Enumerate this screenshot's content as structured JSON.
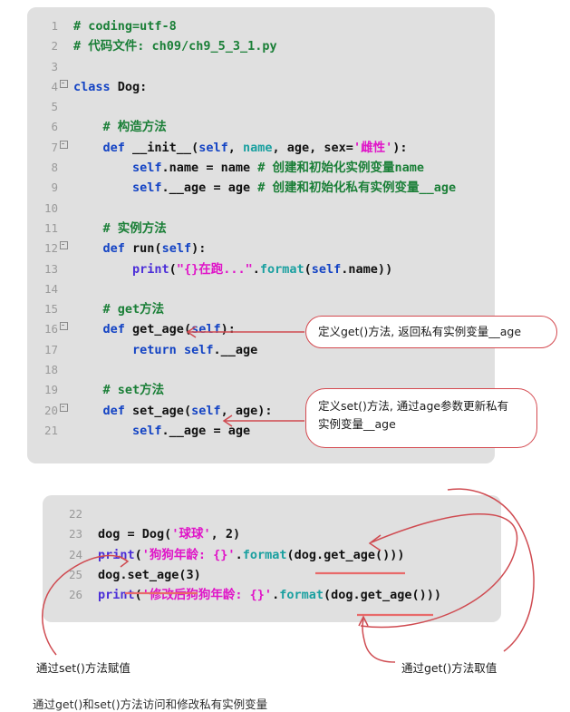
{
  "document": {
    "title": "Python class Dog private attribute get/set example",
    "bottom_caption": "通过get()和set()方法访问和修改私有实例变量"
  },
  "code_block_top": {
    "background": "#e0e0e0",
    "lines": [
      {
        "num": "1",
        "fold": false,
        "tokens": [
          {
            "t": "# coding=utf-8",
            "c": "cmt"
          }
        ]
      },
      {
        "num": "2",
        "fold": false,
        "tokens": [
          {
            "t": "# 代码文件: ch09/ch9_5_3_1.py",
            "c": "cmt"
          }
        ]
      },
      {
        "num": "3",
        "fold": false,
        "tokens": []
      },
      {
        "num": "4",
        "fold": true,
        "tokens": [
          {
            "t": "class ",
            "c": "kw"
          },
          {
            "t": "Dog",
            "c": "cls"
          },
          {
            "t": ":",
            "c": "plain"
          }
        ]
      },
      {
        "num": "5",
        "fold": false,
        "tokens": []
      },
      {
        "num": "6",
        "fold": false,
        "tokens": [
          {
            "t": "    ",
            "c": "plain"
          },
          {
            "t": "# 构造方法",
            "c": "cmt"
          }
        ]
      },
      {
        "num": "7",
        "fold": true,
        "tokens": [
          {
            "t": "    ",
            "c": "plain"
          },
          {
            "t": "def ",
            "c": "kw"
          },
          {
            "t": "__init__",
            "c": "fn"
          },
          {
            "t": "(",
            "c": "plain"
          },
          {
            "t": "self",
            "c": "self"
          },
          {
            "t": ", ",
            "c": "plain"
          },
          {
            "t": "name",
            "c": "param"
          },
          {
            "t": ", ",
            "c": "plain"
          },
          {
            "t": "age",
            "c": "plain"
          },
          {
            "t": ", ",
            "c": "plain"
          },
          {
            "t": "sex=",
            "c": "plain"
          },
          {
            "t": "'雌性'",
            "c": "str"
          },
          {
            "t": "):",
            "c": "plain"
          }
        ]
      },
      {
        "num": "8",
        "fold": false,
        "tokens": [
          {
            "t": "        ",
            "c": "plain"
          },
          {
            "t": "self",
            "c": "self"
          },
          {
            "t": ".name = name ",
            "c": "plain"
          },
          {
            "t": "# 创建和初始化实例变量name",
            "c": "cmt"
          }
        ]
      },
      {
        "num": "9",
        "fold": false,
        "tokens": [
          {
            "t": "        ",
            "c": "plain"
          },
          {
            "t": "self",
            "c": "self"
          },
          {
            "t": ".__age = age ",
            "c": "plain"
          },
          {
            "t": "# 创建和初始化私有实例变量__age",
            "c": "cmt"
          }
        ]
      },
      {
        "num": "10",
        "fold": false,
        "tokens": []
      },
      {
        "num": "11",
        "fold": false,
        "tokens": [
          {
            "t": "    ",
            "c": "plain"
          },
          {
            "t": "# 实例方法",
            "c": "cmt"
          }
        ]
      },
      {
        "num": "12",
        "fold": true,
        "tokens": [
          {
            "t": "    ",
            "c": "plain"
          },
          {
            "t": "def ",
            "c": "kw"
          },
          {
            "t": "run",
            "c": "fn"
          },
          {
            "t": "(",
            "c": "plain"
          },
          {
            "t": "self",
            "c": "self"
          },
          {
            "t": "):",
            "c": "plain"
          }
        ]
      },
      {
        "num": "13",
        "fold": false,
        "tokens": [
          {
            "t": "        ",
            "c": "plain"
          },
          {
            "t": "print",
            "c": "builtin"
          },
          {
            "t": "(",
            "c": "plain"
          },
          {
            "t": "\"{}在跑...\"",
            "c": "str"
          },
          {
            "t": ".",
            "c": "plain"
          },
          {
            "t": "format",
            "c": "method"
          },
          {
            "t": "(",
            "c": "plain"
          },
          {
            "t": "self",
            "c": "self"
          },
          {
            "t": ".name))",
            "c": "plain"
          }
        ]
      },
      {
        "num": "14",
        "fold": false,
        "tokens": []
      },
      {
        "num": "15",
        "fold": false,
        "tokens": [
          {
            "t": "    ",
            "c": "plain"
          },
          {
            "t": "# get方法",
            "c": "cmt"
          }
        ]
      },
      {
        "num": "16",
        "fold": true,
        "tokens": [
          {
            "t": "    ",
            "c": "plain"
          },
          {
            "t": "def ",
            "c": "kw"
          },
          {
            "t": "get_age",
            "c": "fn"
          },
          {
            "t": "(",
            "c": "plain"
          },
          {
            "t": "self",
            "c": "self"
          },
          {
            "t": "):",
            "c": "plain"
          }
        ]
      },
      {
        "num": "17",
        "fold": false,
        "tokens": [
          {
            "t": "        ",
            "c": "plain"
          },
          {
            "t": "return ",
            "c": "kw"
          },
          {
            "t": "self",
            "c": "self"
          },
          {
            "t": ".__age",
            "c": "plain"
          }
        ]
      },
      {
        "num": "18",
        "fold": false,
        "tokens": []
      },
      {
        "num": "19",
        "fold": false,
        "tokens": [
          {
            "t": "    ",
            "c": "plain"
          },
          {
            "t": "# set方法",
            "c": "cmt"
          }
        ]
      },
      {
        "num": "20",
        "fold": true,
        "tokens": [
          {
            "t": "    ",
            "c": "plain"
          },
          {
            "t": "def ",
            "c": "kw"
          },
          {
            "t": "set_age",
            "c": "fn"
          },
          {
            "t": "(",
            "c": "plain"
          },
          {
            "t": "self",
            "c": "self"
          },
          {
            "t": ", ",
            "c": "plain"
          },
          {
            "t": "age",
            "c": "plain"
          },
          {
            "t": "):",
            "c": "plain"
          }
        ]
      },
      {
        "num": "21",
        "fold": false,
        "tokens": [
          {
            "t": "        ",
            "c": "plain"
          },
          {
            "t": "self",
            "c": "self"
          },
          {
            "t": ".__age = age",
            "c": "plain"
          }
        ]
      }
    ]
  },
  "code_block_bottom": {
    "background": "#e0e0e0",
    "lines": [
      {
        "num": "22",
        "fold": false,
        "tokens": []
      },
      {
        "num": "23",
        "fold": false,
        "tokens": [
          {
            "t": "dog = ",
            "c": "plain"
          },
          {
            "t": "Dog",
            "c": "cls"
          },
          {
            "t": "(",
            "c": "plain"
          },
          {
            "t": "'球球'",
            "c": "str"
          },
          {
            "t": ", 2)",
            "c": "plain"
          }
        ]
      },
      {
        "num": "24",
        "fold": false,
        "tokens": [
          {
            "t": "print",
            "c": "builtin"
          },
          {
            "t": "(",
            "c": "plain"
          },
          {
            "t": "'狗狗年龄: {}'",
            "c": "str"
          },
          {
            "t": ".",
            "c": "plain"
          },
          {
            "t": "format",
            "c": "method"
          },
          {
            "t": "(dog.get_age()))",
            "c": "plain"
          }
        ]
      },
      {
        "num": "25",
        "fold": false,
        "tokens": [
          {
            "t": "dog.set_age(3)",
            "c": "plain"
          }
        ]
      },
      {
        "num": "26",
        "fold": false,
        "tokens": [
          {
            "t": "print",
            "c": "builtin"
          },
          {
            "t": "(",
            "c": "plain"
          },
          {
            "t": "'修改后狗狗年龄: {}'",
            "c": "str"
          },
          {
            "t": ".",
            "c": "plain"
          },
          {
            "t": "format",
            "c": "method"
          },
          {
            "t": "(dog.get_age()))",
            "c": "plain"
          }
        ]
      }
    ]
  },
  "annotations": {
    "accent_color": "#cf4b51",
    "underline_color": "#e86a6a",
    "callout_get": "定义get()方法, 返回私有实例变量__age",
    "callout_set_line1": "定义set()方法, 通过age参数更新私有",
    "callout_set_line2": "实例变量__age",
    "label_set": "通过set()方法赋值",
    "label_get": "通过get()方法取值"
  }
}
